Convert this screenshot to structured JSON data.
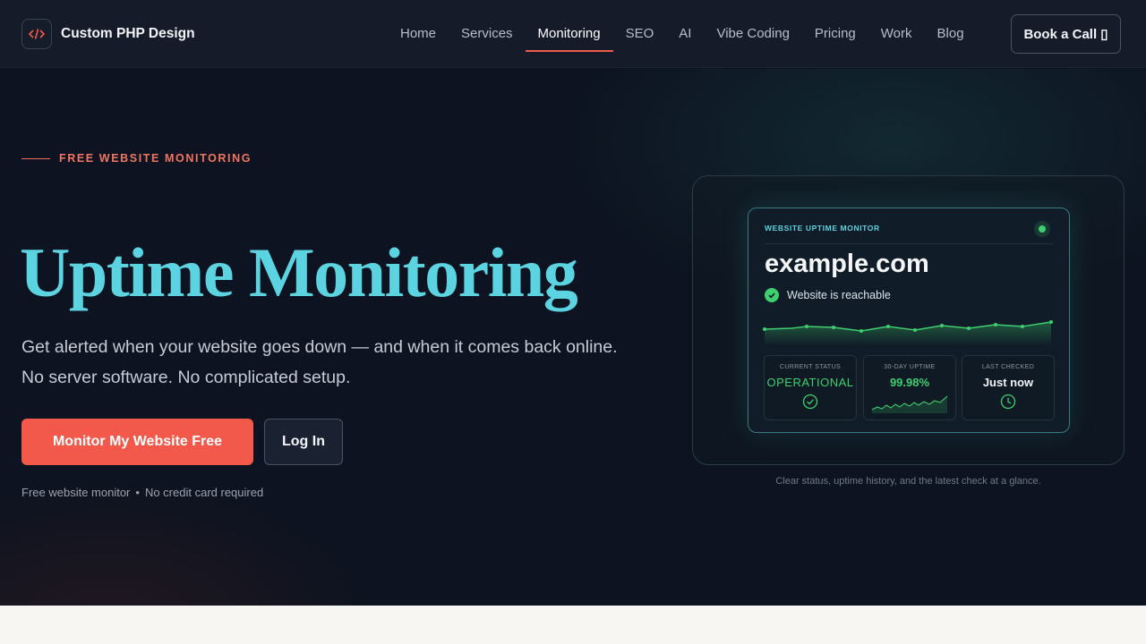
{
  "brand": {
    "name": "Custom PHP Design",
    "logo_glyph": "</>",
    "accent": "#f2594b"
  },
  "nav": {
    "items": [
      {
        "label": "Home"
      },
      {
        "label": "Services"
      },
      {
        "label": "Monitoring",
        "active": true
      },
      {
        "label": "SEO"
      },
      {
        "label": "AI"
      },
      {
        "label": "Vibe Coding"
      },
      {
        "label": "Pricing"
      },
      {
        "label": "Work"
      },
      {
        "label": "Blog"
      }
    ],
    "cta_label": "Book a Call ▯"
  },
  "hero": {
    "eyebrow": "FREE WEBSITE MONITORING",
    "title": "Uptime Monitoring",
    "subtitle": "Get alerted when your website goes down — and when it comes back online. No server software. No complicated setup.",
    "primary_button": "Monitor My Website Free",
    "secondary_button": "Log In",
    "footnote_1": "Free website monitor",
    "footnote_sep": "•",
    "footnote_2": "No credit card required",
    "title_color": "#5bd3e0"
  },
  "monitor_card": {
    "heading": "WEBSITE UPTIME MONITOR",
    "domain": "example.com",
    "status_text": "Website is reachable",
    "stats": [
      {
        "label": "CURRENT STATUS",
        "value": "OPERATIONAL",
        "icon": "check-circle-icon",
        "color": "#3ecf6f"
      },
      {
        "label": "30-DAY UPTIME",
        "value": "99.98%",
        "icon": "sparkline-icon",
        "color": "#3ecf6f"
      },
      {
        "label": "LAST CHECKED",
        "value": "Just now",
        "icon": "clock-icon",
        "color": "#f2f4f7"
      }
    ],
    "caption": "Clear status, uptime history, and the latest check at a glance."
  }
}
